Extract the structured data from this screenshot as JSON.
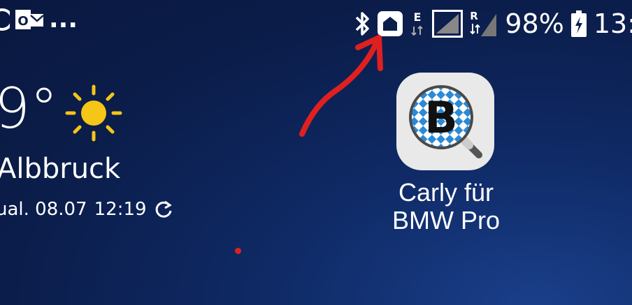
{
  "status_bar": {
    "left_more": "...",
    "outlook_letter": "O",
    "mobile_data_type": "E",
    "roaming_letter": "R",
    "battery_percent": "98%",
    "time": "13:"
  },
  "weather": {
    "temperature": "9°",
    "city": "Albbruck",
    "updated_text": "ual. 08.07",
    "updated_time": "12:19",
    "icon": "sun-icon"
  },
  "app": {
    "icon_letter": "B",
    "label_line1": "Carly für",
    "label_line2": "BMW Pro"
  },
  "annotation_color": "#e02020"
}
